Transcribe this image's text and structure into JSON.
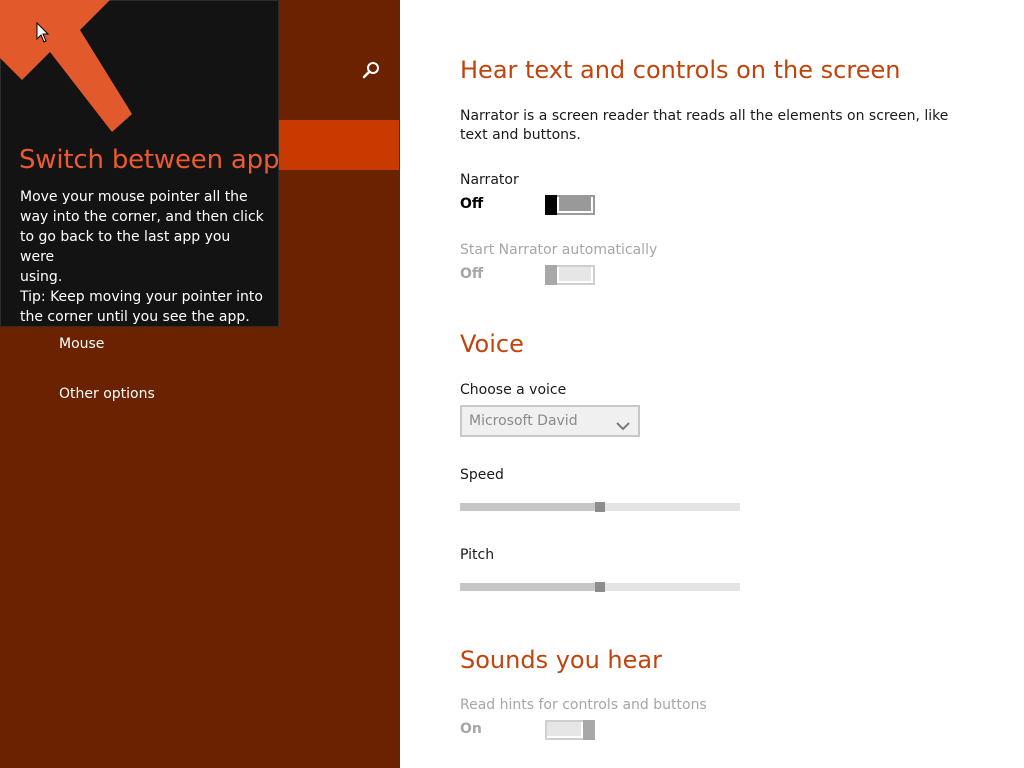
{
  "sidebar": {
    "items": [
      {
        "label": "Mouse"
      },
      {
        "label": "Other options"
      }
    ]
  },
  "tooltip": {
    "title": "Switch between apps",
    "body_lines": [
      "Move your mouse pointer all the",
      "way into the corner, and then click",
      "to go back to the last app you were",
      "using.",
      "Tip: Keep moving your pointer into",
      "the corner until you see the app."
    ]
  },
  "main": {
    "hear_section": {
      "title": "Hear text and controls on the screen",
      "description": "Narrator is a screen reader that reads all the elements on screen, like text and buttons.",
      "narrator": {
        "label": "Narrator",
        "state": "Off"
      },
      "start_auto": {
        "label": "Start Narrator automatically",
        "state": "Off"
      }
    },
    "voice_section": {
      "title": "Voice",
      "choose_label": "Choose a voice",
      "selected_voice": "Microsoft David",
      "speed": {
        "label": "Speed",
        "level_percent": 50
      },
      "pitch": {
        "label": "Pitch",
        "level_percent": 50
      }
    },
    "sounds_section": {
      "title": "Sounds you hear",
      "hints": {
        "label": "Read hints for controls and buttons",
        "state": "On"
      }
    }
  },
  "colors": {
    "sidebar_bg": "#6b2200",
    "sidebar_active": "#c93a00",
    "accent_title": "#c1440e",
    "tooltip_title": "#ec5a2f",
    "arrow": "#e2592c"
  },
  "icons": {
    "search": "search-icon",
    "corner_arrow": "corner-arrow-icon",
    "cursor": "mouse-cursor-icon",
    "chevron": "chevron-down-icon"
  }
}
